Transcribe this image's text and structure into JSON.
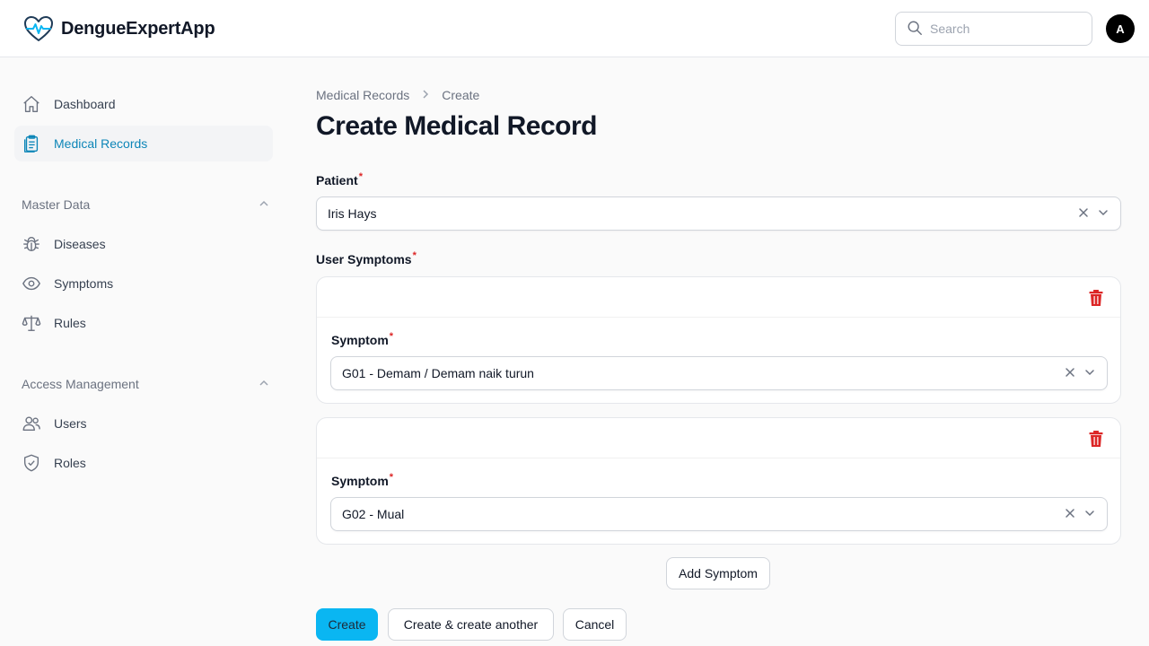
{
  "app": {
    "name": "DengueExpertApp",
    "avatar_initial": "A"
  },
  "search": {
    "placeholder": "Search",
    "value": ""
  },
  "sidebar": {
    "top_items": [
      {
        "label": "Dashboard",
        "icon": "home-icon",
        "active": false
      },
      {
        "label": "Medical Records",
        "icon": "clipboard-icon",
        "active": true
      }
    ],
    "groups": [
      {
        "label": "Master Data",
        "items": [
          {
            "label": "Diseases",
            "icon": "bug-icon"
          },
          {
            "label": "Symptoms",
            "icon": "eye-icon"
          },
          {
            "label": "Rules",
            "icon": "scale-icon"
          }
        ]
      },
      {
        "label": "Access Management",
        "items": [
          {
            "label": "Users",
            "icon": "users-icon"
          },
          {
            "label": "Roles",
            "icon": "shield-check-icon"
          }
        ]
      }
    ]
  },
  "breadcrumb": {
    "parent": "Medical Records",
    "current": "Create"
  },
  "page": {
    "title": "Create Medical Record"
  },
  "form": {
    "patient_label": "Patient",
    "required_mark": "*",
    "patient_value": "Iris Hays",
    "symptoms_label": "User Symptoms",
    "symptom_field_label": "Symptom",
    "symptoms": [
      {
        "value": "G01 - Demam / Demam naik turun"
      },
      {
        "value": "G02 - Mual"
      }
    ],
    "add_symptom_label": "Add Symptom"
  },
  "actions": {
    "create": "Create",
    "create_another": "Create & create another",
    "cancel": "Cancel"
  },
  "colors": {
    "accent": "#0ab6f2",
    "active_nav": "#0e86b8",
    "danger": "#dc2626"
  }
}
